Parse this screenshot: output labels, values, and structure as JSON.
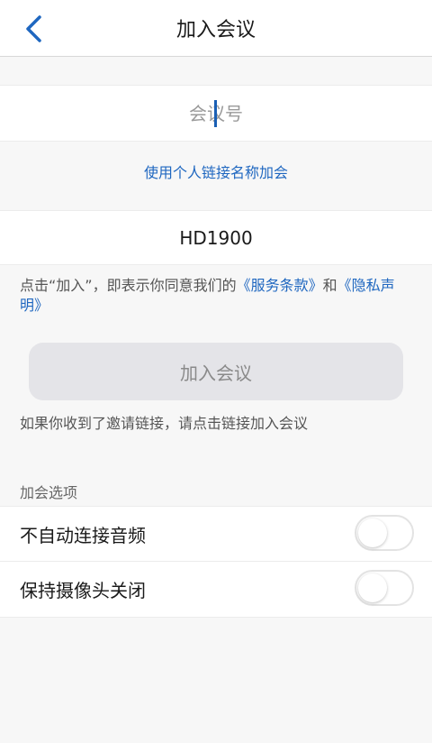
{
  "header": {
    "title": "加入会议",
    "back_icon": "chevron-left-icon"
  },
  "meeting_field": {
    "placeholder": "会议号",
    "value": ""
  },
  "personal_link": {
    "label": "使用个人链接名称加会"
  },
  "nickname_field": {
    "value": "HD1900"
  },
  "terms": {
    "prefix": "点击“加入”，即表示你同意我们的",
    "service_link": "《服务条款》",
    "connector": "和",
    "privacy_link": "《隐私声明》"
  },
  "join_button": {
    "label": "加入会议"
  },
  "invite_note": "如果你收到了邀请链接，请点击链接加入会议",
  "options": {
    "section_title": "加会选项",
    "items": [
      {
        "label": "不自动连接音频",
        "enabled": false
      },
      {
        "label": "保持摄像头关闭",
        "enabled": false
      }
    ]
  },
  "colors": {
    "accent": "#1f67c0",
    "background": "#f7f7f7"
  }
}
